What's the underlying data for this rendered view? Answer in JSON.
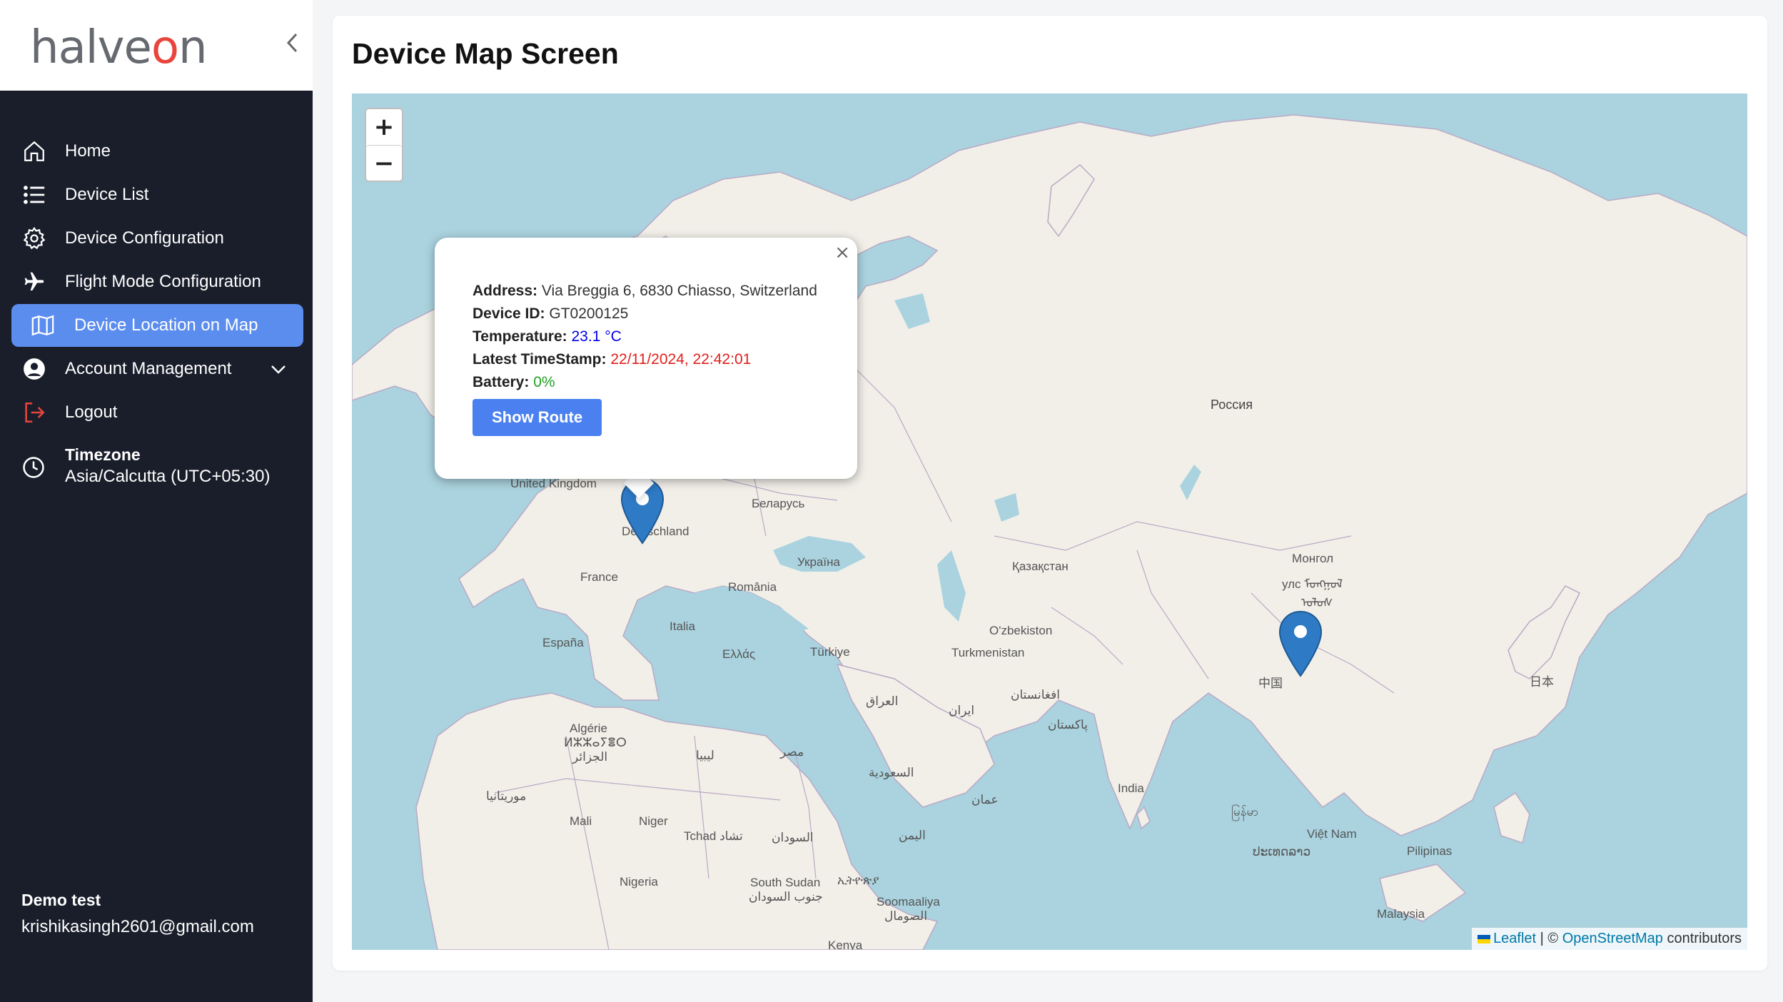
{
  "brand": {
    "logo_text_a": "halve",
    "logo_text_b": "o",
    "logo_text_c": "n"
  },
  "sidebar": {
    "items": [
      {
        "label": "Home",
        "icon": "home-icon"
      },
      {
        "label": "Device List",
        "icon": "list-icon"
      },
      {
        "label": "Device Configuration",
        "icon": "gear-icon"
      },
      {
        "label": "Flight Mode Configuration",
        "icon": "airplane-icon"
      },
      {
        "label": "Device Location on Map",
        "icon": "map-icon",
        "active": true
      },
      {
        "label": "Account Management",
        "icon": "user-circle-icon",
        "has_submenu": true
      },
      {
        "label": "Logout",
        "icon": "logout-icon"
      }
    ],
    "timezone_label": "Timezone",
    "timezone_value": "Asia/Calcutta (UTC+05:30)",
    "user_name": "Demo test",
    "user_email": "krishikasingh2601@gmail.com"
  },
  "page": {
    "title": "Device Map Screen"
  },
  "map": {
    "zoom_in": "+",
    "zoom_out": "−",
    "places": [
      "Россия",
      "United Kingdom",
      "Беларусь",
      "Deutschland",
      "Україна",
      "France",
      "România",
      "Қазақстан",
      "Монгол",
      "улс ᠮᠣᠩᠭᠣᠯ",
      "ᠤᠯᠤᠰ",
      "Italia",
      "España",
      "Ελλάς",
      "Türkiye",
      "O'zbekiston",
      "Turkmenistan",
      "中国",
      "日本",
      "العراق",
      "ایران",
      "افغانستان",
      "پاکستان",
      "Algérie",
      "ⵍⵣⵣⴰⵢⴻⵔ",
      "الجزائر",
      "ليبيا",
      "مصر",
      "موريتانيا",
      "السعودية",
      "عمان",
      "India",
      "မြန်မာ",
      "Mali",
      "Niger",
      "Tchad تشاد",
      "السودان",
      "اليمن",
      "Việt Nam",
      "ປະເທດລາວ",
      "Pilipinas",
      "Nigeria",
      "South Sudan",
      "ኢትዮጵያ",
      "جنوب السودان",
      "Soomaaliya",
      "الصومال",
      "Malaysia",
      "Kenya"
    ],
    "popup": {
      "address_label": "Address:",
      "address_value": "Via Breggia 6, 6830 Chiasso, Switzerland",
      "device_id_label": "Device ID:",
      "device_id_value": "GT0200125",
      "temperature_label": "Temperature:",
      "temperature_value": "23.1 °C",
      "timestamp_label": "Latest TimeStamp:",
      "timestamp_value": "22/11/2024, 22:42:01",
      "battery_label": "Battery:",
      "battery_value": "0%",
      "show_route_label": "Show Route",
      "close_label": "×"
    },
    "attribution": {
      "leaflet": "Leaflet",
      "sep": " | © ",
      "osm": "OpenStreetMap",
      "suffix": " contributors"
    }
  },
  "colors": {
    "sidebar_bg": "#1a1e2b",
    "active_item": "#5b8def",
    "marker": "#2e7ac4",
    "button": "#4a80f0"
  }
}
